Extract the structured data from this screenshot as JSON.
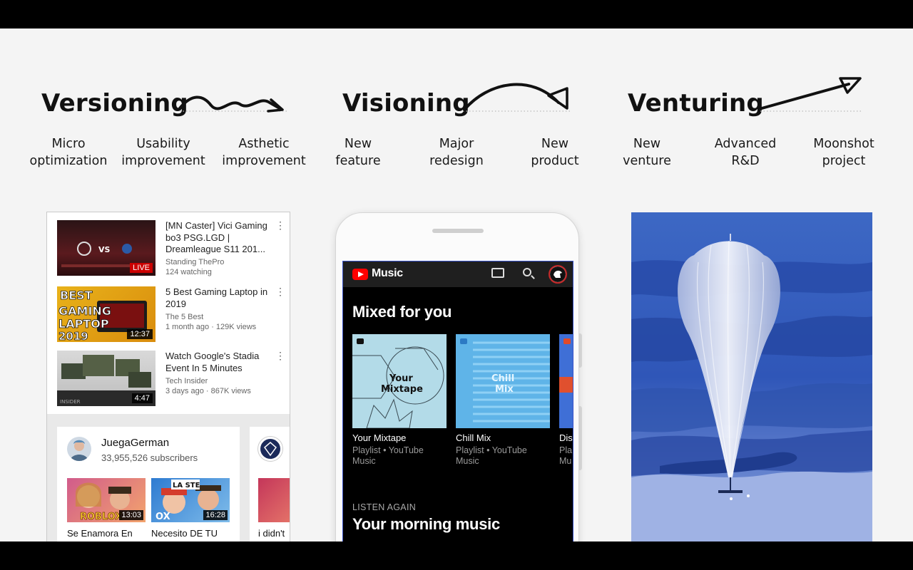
{
  "headings": {
    "versioning": "Versioning",
    "visioning": "Visioning",
    "venturing": "Venturing"
  },
  "labels": [
    {
      "line1": "Micro",
      "line2": "optimization"
    },
    {
      "line1": "Usability",
      "line2": "improvement"
    },
    {
      "line1": "Asthetic",
      "line2": "improvement"
    },
    {
      "line1": "New",
      "line2": "feature"
    },
    {
      "line1": "Major",
      "line2": "redesign"
    },
    {
      "line1": "New",
      "line2": "product"
    },
    {
      "line1": "New",
      "line2": "venture"
    },
    {
      "line1": "Advanced",
      "line2": "R&D"
    },
    {
      "line1": "Moonshot",
      "line2": "project"
    }
  ],
  "youtube": {
    "videos": [
      {
        "title": "[MN Caster] Vici Gaming bo3 PSG.LGD | Dreamleague  S11 201...",
        "channel": "Standing ThePro",
        "meta": "124 watching",
        "badge": "LIVE",
        "thumb_text": "VS"
      },
      {
        "title": "5 Best Gaming Laptop in 2019",
        "channel": "The 5 Best",
        "meta": "1 month ago · 129K views",
        "badge": "12:37",
        "thumb_text": "BEST GAMING LAPTOP 2019"
      },
      {
        "title": "Watch Google's Stadia Event In 5 Minutes",
        "channel": "Tech Insider",
        "meta": "3 days ago · 867K views",
        "badge": "4:47",
        "thumb_text": "INSIDER"
      }
    ],
    "channel": {
      "name": "JuegaGerman",
      "subscribers": "33,955,526 subscribers",
      "videos": [
        {
          "title": "Se Enamora En",
          "duration": "13:03",
          "thumb_text": "ROBLOX"
        },
        {
          "title": "Necesito DE TU",
          "duration": "16:28",
          "thumb_text": "LA STE"
        }
      ],
      "next_title": "i didn't"
    }
  },
  "music_app": {
    "app_name": "Music",
    "section_title": "Mixed for you",
    "cards": [
      {
        "title": "Your Mixtape",
        "subtitle": "Playlist • YouTube Music",
        "art_text": "Your Mixtape",
        "color": "#b3dbe8"
      },
      {
        "title": "Chill Mix",
        "subtitle": "Playlist • YouTube Music",
        "art_text": "Chill Mix",
        "color": "#5fb4e8"
      },
      {
        "title": "Dis",
        "subtitle": "Pla Mu",
        "art_text": "",
        "color": "#3f6fd6"
      }
    ],
    "listen_label": "LISTEN AGAIN",
    "listen_title": "Your morning music"
  },
  "colors": {
    "youtube_red": "#ff0000",
    "slide_bg": "#f4f4f4",
    "sky_blue": "#2f56b8"
  },
  "icons": [
    "cast-icon",
    "search-icon",
    "more-vert-icon",
    "youtube-logo-icon"
  ]
}
